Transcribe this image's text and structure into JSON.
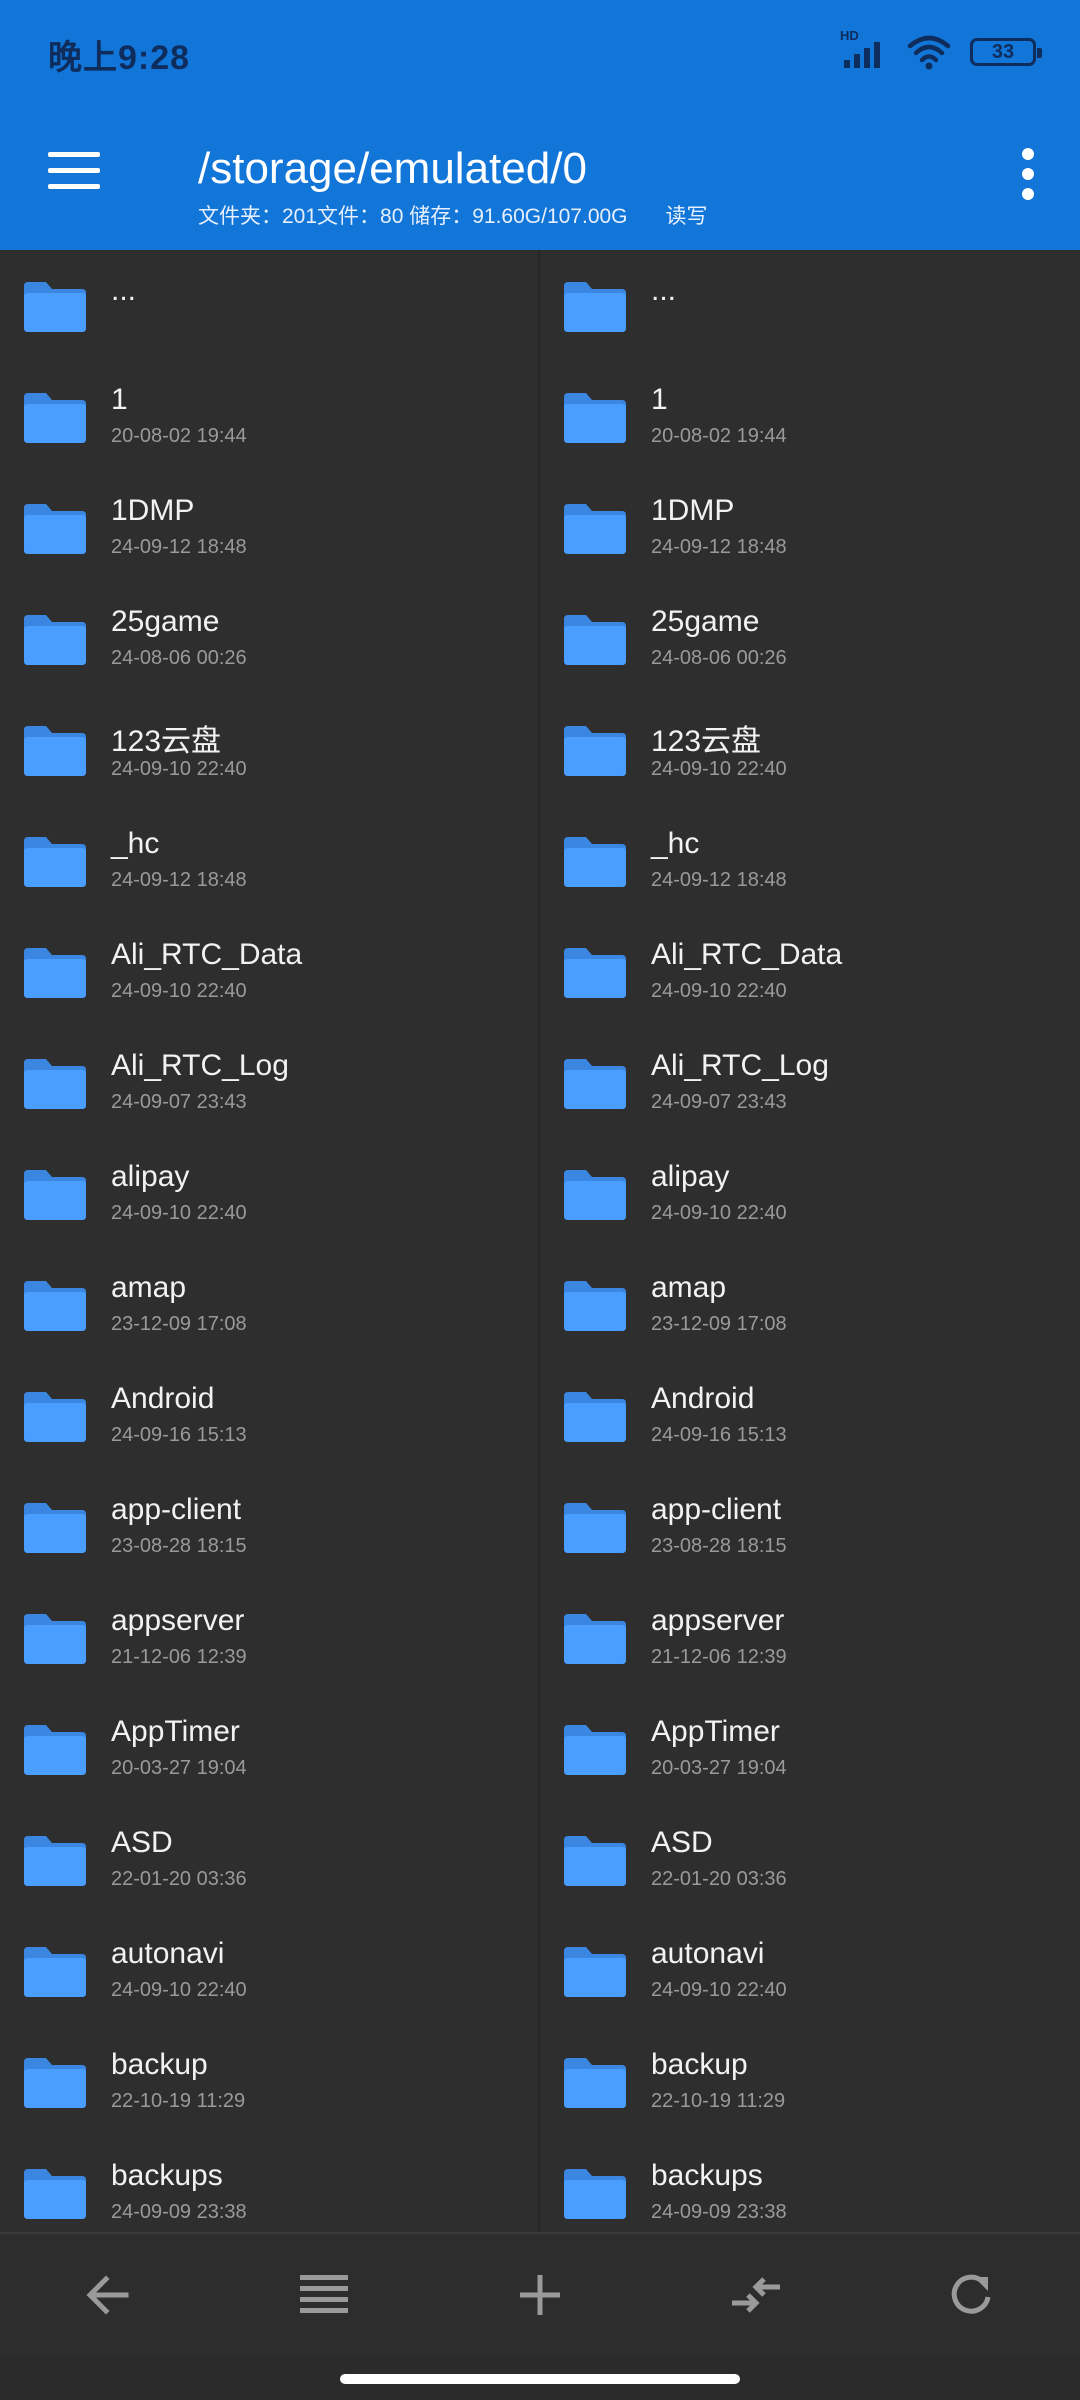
{
  "status": {
    "time": "晚上9:28",
    "hd_label": "HD",
    "battery": "33",
    "colors": {
      "bar": "#1275d8",
      "icons": "#0f2d5c"
    }
  },
  "toolbar": {
    "path": "/storage/emulated/0",
    "info": "文件夹：201文件：80  储存：91.60G/107.00G",
    "access": "读写"
  },
  "colors": {
    "folder": "#4a9eff",
    "folder_dark": "#3a86e0",
    "background": "#2e2e2e",
    "accent": "#1275d8"
  },
  "left_pane": {
    "items": [
      {
        "name": "...",
        "date": ""
      },
      {
        "name": "1",
        "date": "20-08-02 19:44"
      },
      {
        "name": "1DMP",
        "date": "24-09-12 18:48"
      },
      {
        "name": "25game",
        "date": "24-08-06 00:26"
      },
      {
        "name": "123云盘",
        "date": "24-09-10 22:40"
      },
      {
        "name": "_hc",
        "date": "24-09-12 18:48"
      },
      {
        "name": "Ali_RTC_Data",
        "date": "24-09-10 22:40"
      },
      {
        "name": "Ali_RTC_Log",
        "date": "24-09-07 23:43"
      },
      {
        "name": "alipay",
        "date": "24-09-10 22:40"
      },
      {
        "name": "amap",
        "date": "23-12-09 17:08"
      },
      {
        "name": "Android",
        "date": "24-09-16 15:13"
      },
      {
        "name": "app-client",
        "date": "23-08-28 18:15"
      },
      {
        "name": "appserver",
        "date": "21-12-06 12:39"
      },
      {
        "name": "AppTimer",
        "date": "20-03-27 19:04"
      },
      {
        "name": "ASD",
        "date": "22-01-20 03:36"
      },
      {
        "name": "autonavi",
        "date": "24-09-10 22:40"
      },
      {
        "name": "backup",
        "date": "22-10-19 11:29"
      },
      {
        "name": "backups",
        "date": "24-09-09 23:38"
      }
    ]
  },
  "right_pane": {
    "items": [
      {
        "name": "...",
        "date": ""
      },
      {
        "name": "1",
        "date": "20-08-02 19:44"
      },
      {
        "name": "1DMP",
        "date": "24-09-12 18:48"
      },
      {
        "name": "25game",
        "date": "24-08-06 00:26"
      },
      {
        "name": "123云盘",
        "date": "24-09-10 22:40"
      },
      {
        "name": "_hc",
        "date": "24-09-12 18:48"
      },
      {
        "name": "Ali_RTC_Data",
        "date": "24-09-10 22:40"
      },
      {
        "name": "Ali_RTC_Log",
        "date": "24-09-07 23:43"
      },
      {
        "name": "alipay",
        "date": "24-09-10 22:40"
      },
      {
        "name": "amap",
        "date": "23-12-09 17:08"
      },
      {
        "name": "Android",
        "date": "24-09-16 15:13"
      },
      {
        "name": "app-client",
        "date": "23-08-28 18:15"
      },
      {
        "name": "appserver",
        "date": "21-12-06 12:39"
      },
      {
        "name": "AppTimer",
        "date": "20-03-27 19:04"
      },
      {
        "name": "ASD",
        "date": "22-01-20 03:36"
      },
      {
        "name": "autonavi",
        "date": "24-09-10 22:40"
      },
      {
        "name": "backup",
        "date": "22-10-19 11:29"
      },
      {
        "name": "backups",
        "date": "24-09-09 23:38"
      }
    ]
  },
  "bottom_bar": {
    "actions": [
      {
        "icon": "arrow-left-icon"
      },
      {
        "icon": "list-icon"
      },
      {
        "icon": "plus-icon"
      },
      {
        "icon": "swap-arrows-icon"
      },
      {
        "icon": "refresh-icon"
      }
    ],
    "icon_color": "#9a9a9a"
  }
}
